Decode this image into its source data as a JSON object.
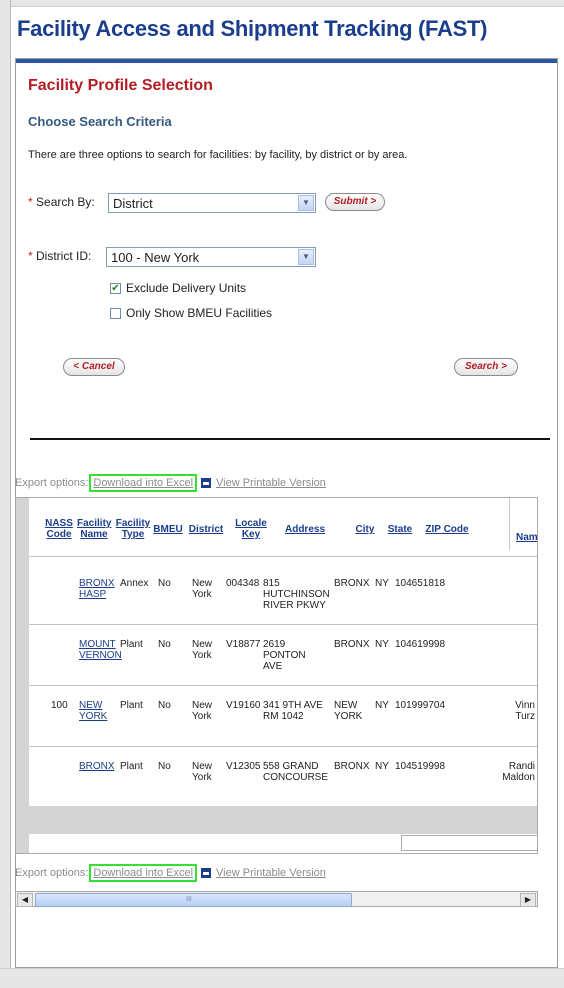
{
  "app_title": "Facility Access and Shipment Tracking (FAST)",
  "section_title": "Facility Profile Selection",
  "subsection_title": "Choose Search Criteria",
  "intro_text": "There are three options to search for facilities: by facility, by district or by area.",
  "search_by": {
    "label": "Search By:",
    "value": "District",
    "submit_label": "Submit >"
  },
  "district_id": {
    "label": "District ID:",
    "value": "100 - New York"
  },
  "checkboxes": [
    {
      "label": "Exclude Delivery Units",
      "checked": true
    },
    {
      "label": "Only Show BMEU Facilities",
      "checked": false
    }
  ],
  "actions": {
    "cancel_label": "< Cancel",
    "search_label": "Search >"
  },
  "export": {
    "prefix": "Export options:",
    "download_label": "Download into Excel",
    "printable_label": "View Printable Version",
    "highlight_color": "#35e035"
  },
  "table": {
    "columns": [
      "NASS Code",
      "Facility Name",
      "Facility Type",
      "BMEU",
      "District",
      "Locale Key",
      "Address",
      "City",
      "State",
      "ZIP Code",
      "Name"
    ],
    "rows": [
      {
        "nass": "",
        "name": "BRONX HASP",
        "type": "Annex",
        "bmeu": "No",
        "district": "New York",
        "locale": "004348",
        "address": "815 HUTCHINSON RIVER PKWY",
        "city": "BRONX",
        "state": "NY",
        "zip": "104651818",
        "contact": ""
      },
      {
        "nass": "",
        "name": "MOUNT VERNON",
        "type": "Plant",
        "bmeu": "No",
        "district": "New York",
        "locale": "V18877",
        "address": "2619 PONTON AVE",
        "city": "BRONX",
        "state": "NY",
        "zip": "104619998",
        "contact": ""
      },
      {
        "nass": "100",
        "name": "NEW YORK",
        "type": "Plant",
        "bmeu": "No",
        "district": "New York",
        "locale": "V19160",
        "address": "341 9TH AVE RM 1042",
        "city": "NEW YORK",
        "state": "NY",
        "zip": "101999704",
        "contact": "Vinn Turz"
      },
      {
        "nass": "",
        "name": "BRONX",
        "type": "Plant",
        "bmeu": "No",
        "district": "New York",
        "locale": "V12305",
        "address": "558 GRAND CONCOURSE",
        "city": "BRONX",
        "state": "NY",
        "zip": "104519998",
        "contact": "Randi Maldon"
      }
    ]
  },
  "scrollbar_thumb_label": "III",
  "colors": {
    "title_blue": "#1a3e8c",
    "section_red": "#b21d24",
    "link_blue": "#1a3e8c"
  }
}
